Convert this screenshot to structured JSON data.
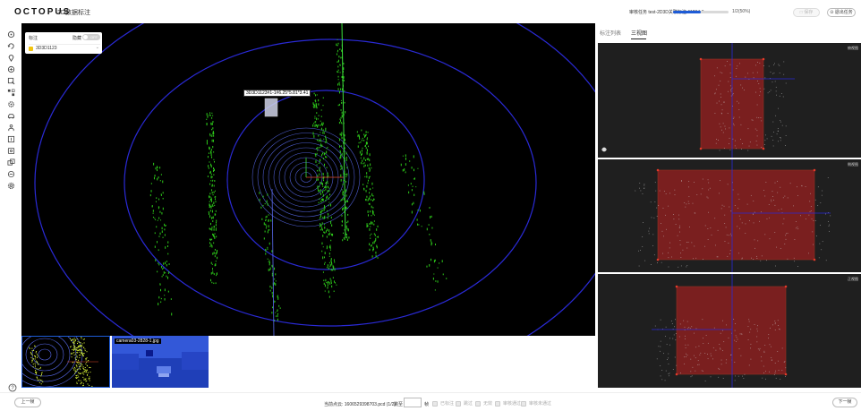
{
  "header": {
    "logo": "OCTOPUS",
    "subtitle": "3D数据标注",
    "task_info": "审核任务 test-2D3D关联标注-11234-0",
    "progress_percent": 50,
    "progress_text": "1/2(50%)",
    "save_label": "□ 保存",
    "exit_label": "⊙ 退出任务"
  },
  "label_panel": {
    "title": "标注",
    "hide_label": "隐藏",
    "toggle_text": "OFF",
    "item": "3D3D1123"
  },
  "box_label": "3D3D1123#1-1#6.25*5.81*3.41",
  "thumbnails": {
    "camera_label": "camera03-2828-1.jpg"
  },
  "right_panel": {
    "tabs": [
      {
        "label": "标注列表",
        "active": false
      },
      {
        "label": "三视图",
        "active": true
      }
    ],
    "views": [
      {
        "label": "俯视图"
      },
      {
        "label": "侧视图"
      },
      {
        "label": "正视图"
      }
    ]
  },
  "footer": {
    "prev_label": "上一帧",
    "next_label": "下一帧",
    "frame_info": "当前点云: 1606529398703.pcd (1/2)",
    "jump_label": "跳至",
    "jump_value": "",
    "frame_unit": "帧",
    "checks": [
      "已标注",
      "跳过",
      "无效",
      "审核通过",
      "审核未通过"
    ]
  },
  "colors": {
    "accent": "#1e5bd6",
    "point_cloud": "#2ecc1a",
    "ring": "#2a2ad6",
    "box": "#8b1f1f"
  }
}
